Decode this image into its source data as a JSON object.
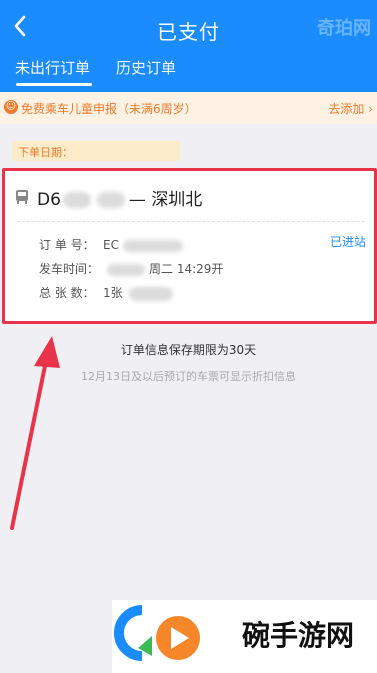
{
  "header": {
    "title": "已支付",
    "watermark": "奇珀网",
    "tabs": [
      {
        "label": "未出行订单",
        "active": true
      },
      {
        "label": "历史订单",
        "active": false
      }
    ]
  },
  "notice": {
    "text": "免费乘车儿童申报（未满6周岁）",
    "action": "去添加 ›"
  },
  "order_date_label": "下单日期：",
  "order": {
    "train_prefix": "D6",
    "separator": "—",
    "destination": "深圳北",
    "status": "已进站",
    "rows": [
      {
        "label": "订 单 号：",
        "value": "EC"
      },
      {
        "label": "发车时间：",
        "value": "周二 14:29开"
      },
      {
        "label": "总 张 数：",
        "value": "1张"
      }
    ]
  },
  "info": {
    "line1": "订单信息保存期限为30天",
    "line2": "12月13日及以后预订的车票可显示折扣信息"
  },
  "footer": {
    "brand": "碗手游网"
  },
  "colors": {
    "header_blue": "#1a8cfe",
    "notice_orange": "#f07b2a",
    "highlight_red": "#e8334a",
    "arrow_pink": "#e8334a"
  }
}
